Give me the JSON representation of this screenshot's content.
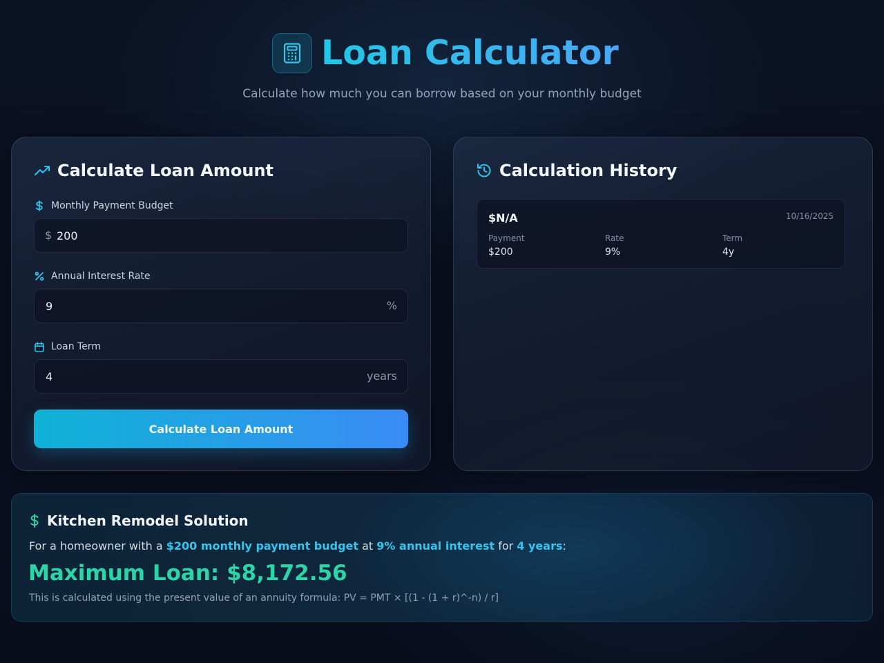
{
  "header": {
    "icon": "calculator-icon",
    "title": "Loan Calculator",
    "subtitle": "Calculate how much you can borrow based on your monthly budget"
  },
  "calculator": {
    "title": "Calculate Loan Amount",
    "title_icon": "trending-up-icon",
    "fields": {
      "payment": {
        "label": "Monthly Payment Budget",
        "icon": "dollar-icon",
        "prefix": "$",
        "value": "200"
      },
      "rate": {
        "label": "Annual Interest Rate",
        "icon": "percent-icon",
        "value": "9",
        "suffix": "%"
      },
      "term": {
        "label": "Loan Term",
        "icon": "calendar-icon",
        "value": "4",
        "suffix": "years"
      }
    },
    "button_label": "Calculate Loan Amount"
  },
  "history": {
    "title": "Calculation History",
    "title_icon": "history-icon",
    "items": [
      {
        "amount": "$N/A",
        "date": "10/16/2025",
        "payment_label": "Payment",
        "payment_value": "$200",
        "rate_label": "Rate",
        "rate_value": "9%",
        "term_label": "Term",
        "term_value": "4y"
      }
    ]
  },
  "solution": {
    "title": "Kitchen Remodel Solution",
    "title_icon": "dollar-icon",
    "text_1": "For a homeowner with a ",
    "highlight_1": "$200 monthly payment budget",
    "text_2": " at ",
    "highlight_2": "9% annual interest",
    "text_3": " for ",
    "highlight_3": "4 years",
    "text_4": ":",
    "max_loan": "Maximum Loan: $8,172.56",
    "formula": "This is calculated using the present value of an annuity formula: PV = PMT × [(1 - (1 + r)^-n) / r]"
  },
  "colors": {
    "accent": "#22c3e6",
    "accent_blue": "#3a8cf5",
    "success": "#2dd4a8"
  }
}
